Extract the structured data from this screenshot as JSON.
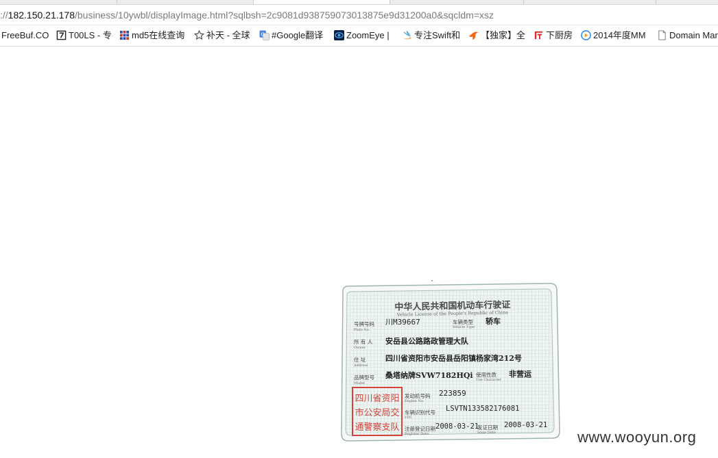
{
  "browser": {
    "url_prefix": "://",
    "url_host": "182.150.21.178",
    "url_path": "/business/10ywbl/displayImage.html?sqlbsh=2c9081d938759073013875e9d31200a0&sqcldm=xsz",
    "bookmarks": [
      {
        "label": "FreeBuf.CO",
        "icon": "none"
      },
      {
        "label": "T00LS - 专",
        "icon": "tools-icon"
      },
      {
        "label": "md5在线查询",
        "icon": "grid-icon"
      },
      {
        "label": "补天 - 全球",
        "icon": "star-icon"
      },
      {
        "label": "#Google翻译",
        "icon": "google-translate-icon"
      },
      {
        "label": "ZoomEye |",
        "icon": "zoomeye-icon"
      },
      {
        "label": "专注Swift和",
        "icon": "swift-icon"
      },
      {
        "label": "【独家】全",
        "icon": "bird-icon"
      },
      {
        "label": "下厨房",
        "icon": "kitchen-icon"
      },
      {
        "label": "2014年度MM",
        "icon": "play-icon"
      },
      {
        "label": "Domain Mar",
        "icon": "document-icon"
      }
    ]
  },
  "license": {
    "title_cn": "中华人民共和国机动车行驶证",
    "title_en": "Vehicle License of the People's Republic of China",
    "plate_label": "号牌号码",
    "plate_label_en": "Plate No.",
    "plate": "川M39667",
    "type_label": "车辆类型",
    "type_label_en": "Vehicle Type",
    "type": "轿车",
    "owner_label": "所 有 人",
    "owner_label_en": "Owner",
    "owner": "安岳县公路路政管理大队",
    "address_label": "住    址",
    "address_label_en": "Address",
    "address": "四川省资阳市安岳县岳阳镇杨家湾212号",
    "model_label": "品牌型号",
    "model_label_en": "Model",
    "model": "桑塔纳牌SVW7182HQi",
    "use_label": "使用性质",
    "use_label_en": "Use Character",
    "use": "非营运",
    "engine_label": "发动机号码",
    "engine_label_en": "Engine No.",
    "engine": "223859",
    "vin_label": "车辆识别代号",
    "vin_label_en": "VIN",
    "vin": "LSVTN133582176081",
    "register_label": "注册登记日期",
    "register_label_en": "Register Date",
    "register_date": "2008-03-21",
    "issue_label": "发证日期",
    "issue_label_en": "Issue Date",
    "issue_date": "2008-03-21",
    "stamp_line1": "四川省资阳",
    "stamp_line2": "市公安局交",
    "stamp_line3": "通警察支队"
  },
  "watermark": "www.wooyun.org"
}
